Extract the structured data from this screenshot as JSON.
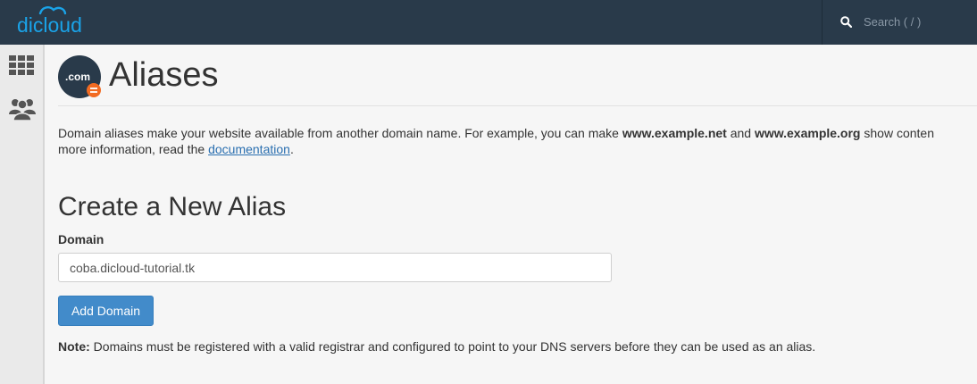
{
  "topbar": {
    "logo_text": "dicloud",
    "search_placeholder": "Search ( / )",
    "search_icon": "search-icon"
  },
  "sidebar": {
    "items": [
      {
        "icon": "apps-grid-icon"
      },
      {
        "icon": "users-icon"
      }
    ]
  },
  "header": {
    "icon_text": ".com",
    "title": "Aliases"
  },
  "description": {
    "part1": "Domain aliases make your website available from another domain name. For example, you can make ",
    "bold1": "www.example.net",
    "part2": " and ",
    "bold2": "www.example.org",
    "part3": " show conten",
    "part4": "more information, read the ",
    "link": "documentation",
    "part5": "."
  },
  "create_section": {
    "title": "Create a New Alias",
    "domain_label": "Domain",
    "domain_value": "coba.dicloud-tutorial.tk",
    "button_label": "Add Domain",
    "note_label": "Note:",
    "note_text": " Domains must be registered with a valid registrar and configured to point to your DNS servers before they can be used as an alias."
  },
  "colors": {
    "topbar_bg": "#293a4a",
    "accent": "#428bca",
    "badge": "#f26b22",
    "logo": "#1aa3e8"
  }
}
